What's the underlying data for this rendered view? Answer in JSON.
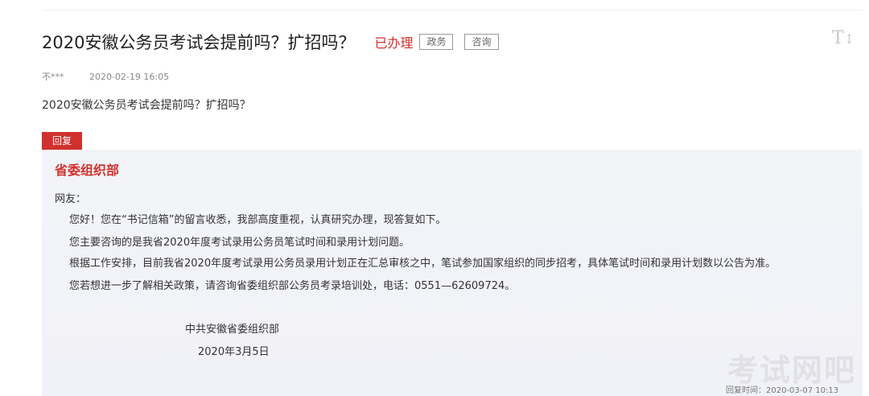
{
  "header": {
    "title": "2020安徽公务员考试会提前吗？扩招吗？",
    "status": "已办理",
    "tags": [
      "政务",
      "咨询"
    ]
  },
  "meta": {
    "author": "不***",
    "date": "2020-02-19 16:05"
  },
  "question": "2020安徽公务员考试会提前吗？扩招吗？",
  "reply": {
    "badge": "回复",
    "department": "省委组织部",
    "greeting": "网友：",
    "paragraphs": [
      "您好！您在“书记信箱”的留言收悉，我部高度重视，认真研究办理，现答复如下。",
      "您主要咨询的是我省2020年度考试录用公务员笔试时间和录用计划问题。",
      "根据工作安排，目前我省2020年度考试录用公务员录用计划正在汇总审核之中，笔试参加国家组织的同步招考，具体笔试时间和录用计划数以公告为准。",
      "您若想进一步了解相关政策，请咨询省委组织部公务员考录培训处，电话：0551—62609724。"
    ],
    "signature": "中共安徽省委组织部",
    "signature_date": "2020年3月5日",
    "reply_time": "回复时间：2020-03-07 10:13"
  },
  "watermark": "考试网吧",
  "colors": {
    "accent": "#d0312d",
    "reply_bg": "#f3f4f8"
  },
  "icons": {
    "font_size": "font-size-icon"
  }
}
